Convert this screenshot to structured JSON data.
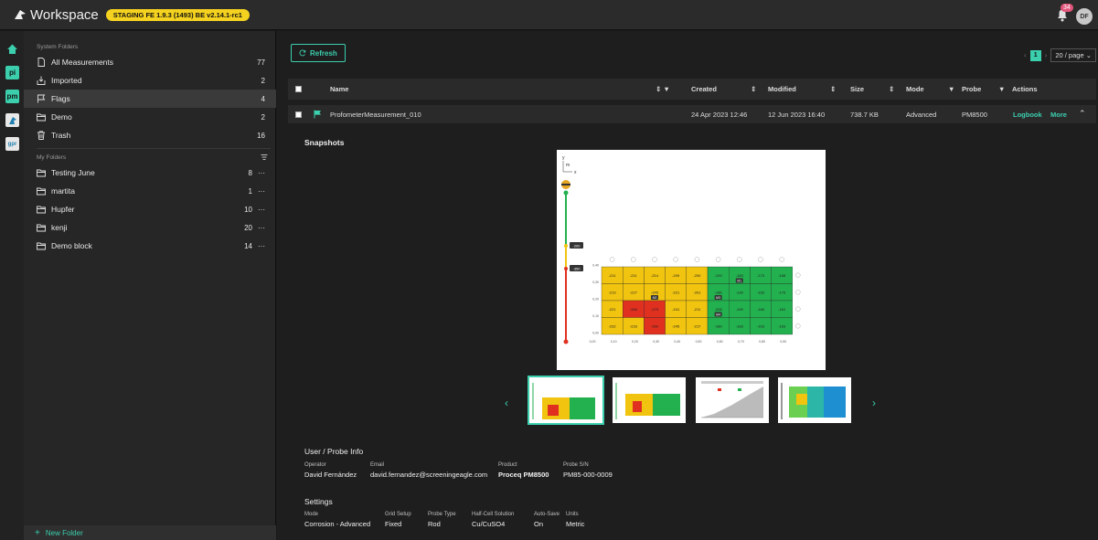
{
  "app": {
    "title": "Workspace",
    "staging_badge": "STAGING FE 1.9.3 (1493) BE v2.14.1-rc1",
    "notifications": "34",
    "avatar_initials": "DF"
  },
  "rail": [
    {
      "name": "home",
      "label": ""
    },
    {
      "name": "pi",
      "label": "pi"
    },
    {
      "name": "pm",
      "label": "pm"
    },
    {
      "name": "eagle",
      "label": ""
    },
    {
      "name": "gpr",
      "label": "gpr"
    }
  ],
  "sidebar": {
    "system_label": "System Folders",
    "system_items": [
      {
        "label": "All Measurements",
        "count": "77",
        "icon": "file-icon"
      },
      {
        "label": "Imported",
        "count": "2",
        "icon": "import-icon"
      },
      {
        "label": "Flags",
        "count": "4",
        "icon": "flag-icon"
      },
      {
        "label": "Demo",
        "count": "2",
        "icon": "folder-icon"
      },
      {
        "label": "Trash",
        "count": "16",
        "icon": "trash-icon"
      }
    ],
    "my_label": "My Folders",
    "my_items": [
      {
        "label": "Testing June",
        "count": "8"
      },
      {
        "label": "martita",
        "count": "1"
      },
      {
        "label": "Hupfer",
        "count": "10"
      },
      {
        "label": "kenji",
        "count": "20"
      },
      {
        "label": "Demo block",
        "count": "14"
      }
    ],
    "new_folder": "New Folder"
  },
  "toolbar": {
    "refresh": "Refresh",
    "page": "1",
    "per_page": "20 / page"
  },
  "table": {
    "headers": {
      "name": "Name",
      "created": "Created",
      "modified": "Modified",
      "size": "Size",
      "mode": "Mode",
      "probe": "Probe",
      "actions": "Actions"
    },
    "row": {
      "name": "ProfometerMeasurement_010",
      "created": "24 Apr 2023 12:46",
      "modified": "12 Jun 2023 16:40",
      "size": "738.7 KB",
      "mode": "Advanced",
      "probe": "PM8500",
      "logbook": "Logbook",
      "more": "More"
    }
  },
  "snapshots": {
    "title": "Snapshots",
    "grid_values": [
      [
        "-211",
        "-211",
        "-214",
        "-209",
        "-200",
        "-193",
        "-183",
        "-173",
        "-168"
      ],
      [
        "-219",
        "-227",
        "-245",
        "-221",
        "-201",
        "-186",
        "-190",
        "-165",
        "-175"
      ],
      [
        "-221",
        "-266",
        "-279",
        "-241",
        "-211",
        "-208",
        "-190",
        "-166",
        "-161"
      ],
      [
        "-232",
        "-233",
        "-260",
        "-245",
        "-217",
        "-189",
        "-183",
        "-153",
        "-163"
      ]
    ],
    "grid_colors": [
      [
        "y",
        "y",
        "y",
        "y",
        "y",
        "g",
        "g",
        "g",
        "g"
      ],
      [
        "y",
        "y",
        "y",
        "y",
        "y",
        "g",
        "g",
        "g",
        "g"
      ],
      [
        "y",
        "r",
        "r",
        "y",
        "y",
        "g",
        "g",
        "g",
        "g"
      ],
      [
        "y",
        "y",
        "r",
        "y",
        "y",
        "g",
        "g",
        "g",
        "g"
      ]
    ],
    "x_ticks": [
      "0,00",
      "0,10",
      "0,20",
      "0,30",
      "0,40",
      "0,50",
      "0,60",
      "0,70",
      "0,80",
      "0,90"
    ],
    "y_ticks": [
      "0,40",
      "0,30",
      "0,20",
      "0,10",
      "0,00"
    ],
    "axis_x": "x",
    "axis_y": "y",
    "unit": "m",
    "scale_marks": [
      "-200",
      "-350"
    ],
    "tags": [
      "M1",
      "M2",
      "M3",
      "M4"
    ]
  },
  "info": {
    "title": "User / Probe Info",
    "fields": [
      {
        "label": "Operator",
        "value": "David Fernández"
      },
      {
        "label": "Email",
        "value": "david.fernandez@screeningeagle.com"
      },
      {
        "label": "Product",
        "value": "Proceq PM8500"
      },
      {
        "label": "Probe S/N",
        "value": "PM85-000-0009"
      }
    ]
  },
  "settings": {
    "title": "Settings",
    "fields": [
      {
        "label": "Mode",
        "value": "Corrosion - Advanced"
      },
      {
        "label": "Grid Setup",
        "value": "Fixed"
      },
      {
        "label": "Probe Type",
        "value": "Rod"
      },
      {
        "label": "Half-Cell Solution",
        "value": "Cu/CuSO4"
      },
      {
        "label": "Auto-Save",
        "value": "On"
      },
      {
        "label": "Units",
        "value": "Metric"
      }
    ]
  }
}
